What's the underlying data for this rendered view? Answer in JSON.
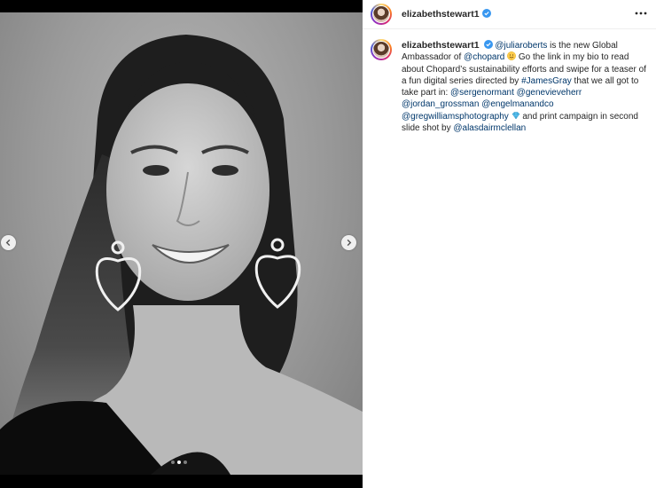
{
  "post": {
    "username": "elizabethstewart1",
    "verified_icon": "verified-badge-icon",
    "more_icon": "more-options-icon",
    "slides": {
      "count": 3,
      "active": 2
    }
  },
  "caption": {
    "username": "elizabethstewart1",
    "m_julia": "@juliaroberts",
    "t1": " is the new Global Ambassador of ",
    "m_chopard": "@chopard",
    "t2": " Go the link in my bio to read about Chopard’s sustainability efforts and swipe for a teaser of a fun digital series directed by ",
    "h_james": "#JamesGray",
    "t3": " that we all got to take part in: ",
    "m_serge": "@sergenormant",
    "m_gen": "@genevieveherr",
    "m_jordan": "@jordan_grossman",
    "m_engel": "@engelmanandco",
    "m_greg": "@gregwilliamsphotography",
    "t4": " and print campaign in second slide shot by ",
    "m_alas": "@alasdairmclellan"
  },
  "colors": {
    "link": "#00376b",
    "verified": "#3897f0",
    "text": "#262626"
  }
}
